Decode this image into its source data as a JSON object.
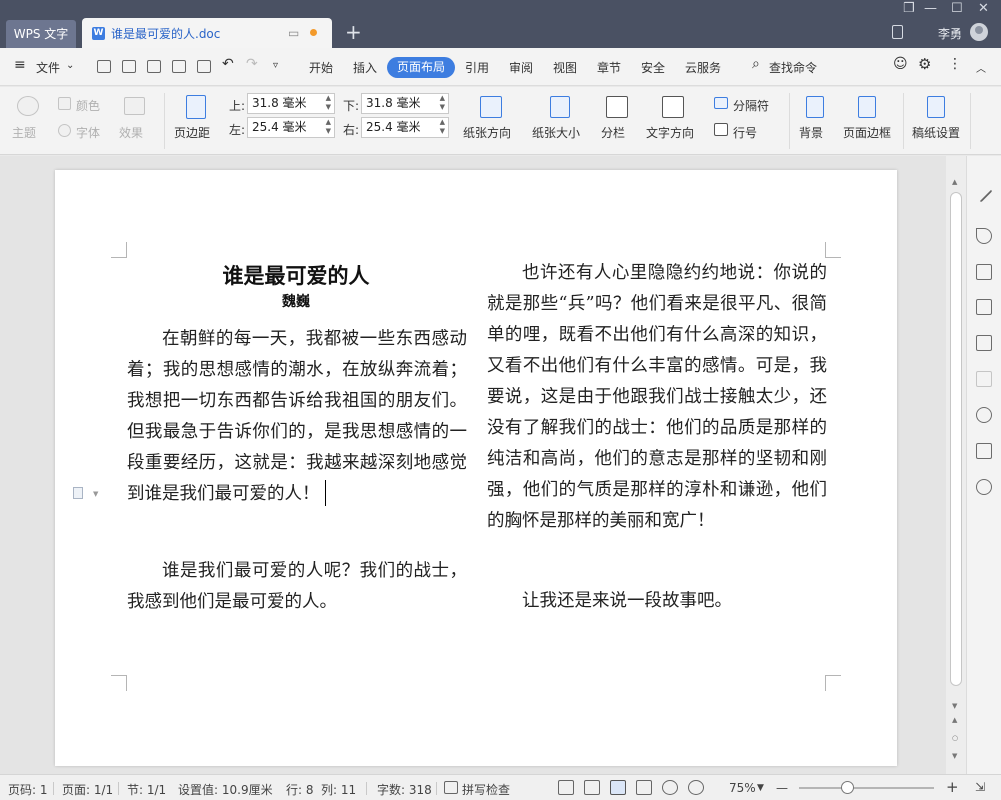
{
  "titlebar": {
    "app_tab": "WPS 文字",
    "doc_tab_title": "谁是最可爱的人.doc",
    "new_tab_symbol": "+",
    "user_name": "李勇",
    "win_minimize": "—",
    "win_restore": "☐",
    "win_close": "✕"
  },
  "menubar": {
    "file_label": "文件",
    "tabs": [
      "开始",
      "插入",
      "页面布局",
      "引用",
      "审阅",
      "视图",
      "章节",
      "安全",
      "云服务"
    ],
    "active_tab": "页面布局",
    "search_label": "查找命令"
  },
  "ribbon": {
    "theme": "主题",
    "colors": "颜色",
    "fonts": "字体",
    "effects": "效果",
    "margins": "页边距",
    "top_label": "上:",
    "top_value": "31.8 毫米",
    "bottom_label": "下:",
    "bottom_value": "31.8 毫米",
    "left_label": "左:",
    "left_value": "25.4 毫米",
    "right_label": "右:",
    "right_value": "25.4 毫米",
    "orientation": "纸张方向",
    "paper_size": "纸张大小",
    "columns": "分栏",
    "text_direction": "文字方向",
    "separator": "分隔符",
    "line_number": "行号",
    "background": "背景",
    "page_border": "页面边框",
    "manuscript": "稿纸设置"
  },
  "document": {
    "title": "谁是最可爱的人",
    "author": "魏巍",
    "col1_p1": "在朝鲜的每一天，我都被一些东西感动着；我的思想感情的潮水，在放纵奔流着；我想把一切东西都告诉给我祖国的朋友们。但我最急于告诉你们的，是我思想感情的一段重要经历，这就是：我越来越深刻地感觉到谁是我们最可爱的人！",
    "col1_p2": "谁是我们最可爱的人呢？我们的战士，我感到他们是最可爱的人。",
    "col2_p1": "也许还有人心里隐隐约约地说：你说的就是那些“兵”吗？他们看来是很平凡、很简单的哩，既看不出他们有什么高深的知识，又看不出他们有什么丰富的感情。可是，我要说，这是由于他跟我们战士接触太少，还没有了解我们的战士：他们的品质是那样的纯洁和高尚，他们的意志是那样的坚韧和刚强，他们的气质是那样的淳朴和谦逊，他们的胸怀是那样的美丽和宽广！",
    "col2_p2": "让我还是来说一段故事吧。"
  },
  "statusbar": {
    "page_code": "页码: 1",
    "pages": "页面: 1/1",
    "section": "节: 1/1",
    "setting_value": "设置值: 10.9厘米",
    "row": "行: 8",
    "col": "列: 11",
    "word_count": "字数: 318",
    "spell_check": "拼写检查",
    "zoom": "75%",
    "zoom_minus": "—",
    "zoom_plus": "+",
    "zoom_level": 0.75
  },
  "colors": {
    "accent": "#3d7de0",
    "titlebar": "#4a5163",
    "tab_dot": "#f39a2b"
  }
}
